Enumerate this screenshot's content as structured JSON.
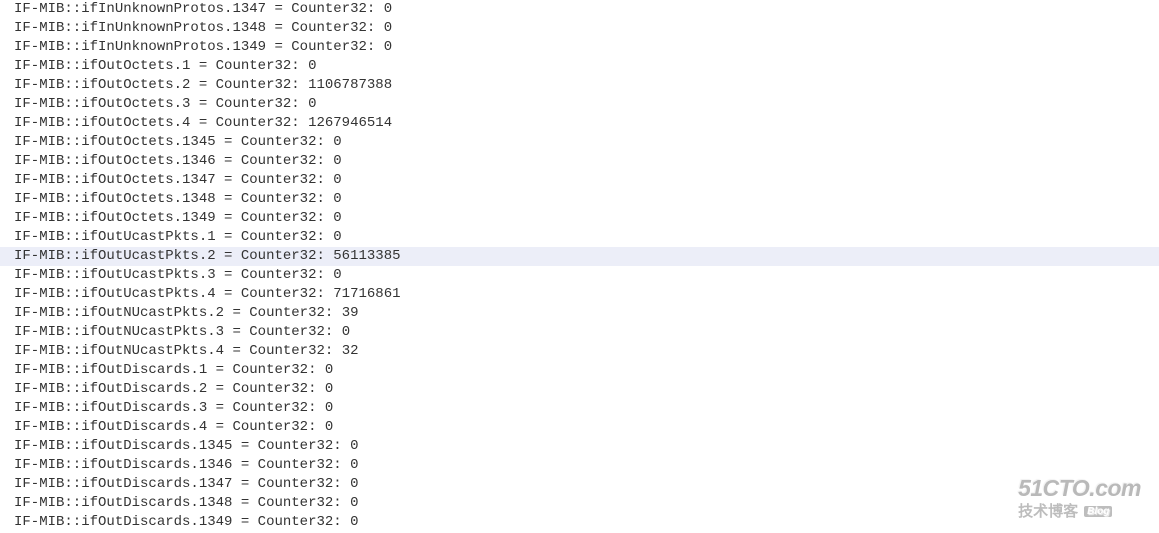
{
  "prefix": "IF-MIB::",
  "typeLabel": "Counter32:",
  "highlightIndex": 13,
  "lines": [
    {
      "oid": "ifInUnknownProtos.1347",
      "value": "0"
    },
    {
      "oid": "ifInUnknownProtos.1348",
      "value": "0"
    },
    {
      "oid": "ifInUnknownProtos.1349",
      "value": "0"
    },
    {
      "oid": "ifOutOctets.1",
      "value": "0"
    },
    {
      "oid": "ifOutOctets.2",
      "value": "1106787388"
    },
    {
      "oid": "ifOutOctets.3",
      "value": "0"
    },
    {
      "oid": "ifOutOctets.4",
      "value": "1267946514"
    },
    {
      "oid": "ifOutOctets.1345",
      "value": "0"
    },
    {
      "oid": "ifOutOctets.1346",
      "value": "0"
    },
    {
      "oid": "ifOutOctets.1347",
      "value": "0"
    },
    {
      "oid": "ifOutOctets.1348",
      "value": "0"
    },
    {
      "oid": "ifOutOctets.1349",
      "value": "0"
    },
    {
      "oid": "ifOutUcastPkts.1",
      "value": "0"
    },
    {
      "oid": "ifOutUcastPkts.2",
      "value": "56113385"
    },
    {
      "oid": "ifOutUcastPkts.3",
      "value": "0"
    },
    {
      "oid": "ifOutUcastPkts.4",
      "value": "71716861"
    },
    {
      "oid": "ifOutNUcastPkts.2",
      "value": "39"
    },
    {
      "oid": "ifOutNUcastPkts.3",
      "value": "0"
    },
    {
      "oid": "ifOutNUcastPkts.4",
      "value": "32"
    },
    {
      "oid": "ifOutDiscards.1",
      "value": "0"
    },
    {
      "oid": "ifOutDiscards.2",
      "value": "0"
    },
    {
      "oid": "ifOutDiscards.3",
      "value": "0"
    },
    {
      "oid": "ifOutDiscards.4",
      "value": "0"
    },
    {
      "oid": "ifOutDiscards.1345",
      "value": "0"
    },
    {
      "oid": "ifOutDiscards.1346",
      "value": "0"
    },
    {
      "oid": "ifOutDiscards.1347",
      "value": "0"
    },
    {
      "oid": "ifOutDiscards.1348",
      "value": "0"
    },
    {
      "oid": "ifOutDiscards.1349",
      "value": "0"
    }
  ],
  "watermark": {
    "top": "51CTO.com",
    "bottomLeft": "技术博客",
    "badge": "Blog"
  }
}
